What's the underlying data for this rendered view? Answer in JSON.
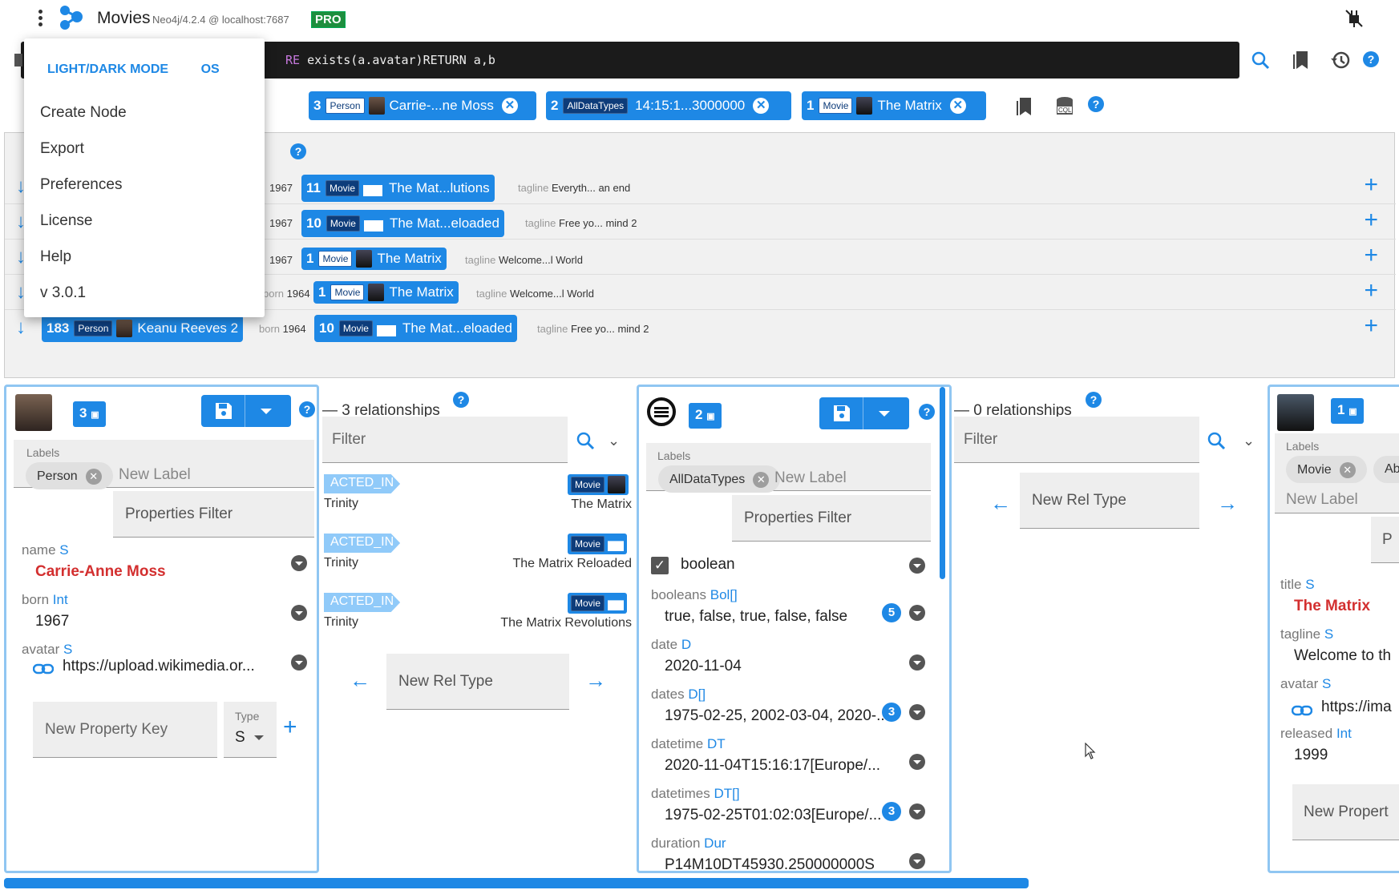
{
  "header": {
    "app_title": "Movies",
    "server": "Neo4j/4.2.4 @ localhost:7687",
    "pro_badge": "PRO"
  },
  "query": {
    "text_kw": "RE",
    "text_rest": " exists(a.avatar)RETURN a,b"
  },
  "menu": {
    "mode_label": "LIGHT/DARK MODE",
    "mode_value": "OS",
    "items": [
      "Create Node",
      "Export",
      "Preferences",
      "License",
      "Help",
      "v 3.0.1"
    ]
  },
  "top_chips": [
    {
      "id": "3",
      "label": "Person",
      "text": "Carrie-...ne Moss"
    },
    {
      "id": "2",
      "label": "AllDataTypes",
      "text": "14:15:1...3000000"
    },
    {
      "id": "1",
      "label": "Movie",
      "text": "The Matrix"
    }
  ],
  "results": {
    "rows": [
      {
        "meta1": "1967",
        "id": "11",
        "label": "Movie",
        "title": "The Mat...lutions",
        "key": "tagline",
        "val": "Everyth... an end"
      },
      {
        "meta1": "1967",
        "id": "10",
        "label": "Movie",
        "title": "The Mat...eloaded",
        "key": "tagline",
        "val": "Free yo... mind 2"
      },
      {
        "meta1": "1967",
        "id": "1",
        "label": "Movie",
        "title": "The Matrix",
        "key": "tagline",
        "val": "Welcome...l World"
      },
      {
        "meta1": "1964",
        "metakey": "born",
        "id": "1",
        "label": "Movie",
        "title": "The Matrix",
        "key": "tagline",
        "val": "Welcome...l World"
      },
      {
        "person_id": "183",
        "person_label": "Person",
        "person_name": "Keanu Reeves 2",
        "metakey": "born",
        "meta1": "1964",
        "id": "10",
        "label": "Movie",
        "title": "The Mat...eloaded",
        "key": "tagline",
        "val": "Free yo... mind 2"
      }
    ]
  },
  "pane1": {
    "cql_count": "3",
    "labels_caption": "Labels",
    "label_chip": "Person",
    "new_label_placeholder": "New Label",
    "properties_filter": "Properties Filter",
    "props": [
      {
        "key": "name",
        "type": "S",
        "value": "Carrie-Anne Moss"
      },
      {
        "key": "born",
        "type": "Int",
        "value": "1967"
      },
      {
        "key": "avatar",
        "type": "S",
        "value": "https://upload.wikimedia.or..."
      }
    ],
    "new_property_key": "New Property Key",
    "type_caption": "Type",
    "type_value": "S"
  },
  "rels1": {
    "count_text": "3 relationships",
    "filter_placeholder": "Filter",
    "items": [
      {
        "type": "ACTED_IN",
        "role": "Trinity",
        "label": "Movie",
        "target": "The Matrix"
      },
      {
        "type": "ACTED_IN",
        "role": "Trinity",
        "label": "Movie",
        "target": "The Matrix Reloaded"
      },
      {
        "type": "ACTED_IN",
        "role": "Trinity",
        "label": "Movie",
        "target": "The Matrix Revolutions"
      }
    ],
    "new_rel_type": "New Rel Type"
  },
  "pane2": {
    "cql_count": "2",
    "labels_caption": "Labels",
    "label_chip": "AllDataTypes",
    "new_label_placeholder": "New Label",
    "properties_filter": "Properties Filter",
    "boolean_key": "boolean",
    "props": [
      {
        "key": "booleans",
        "type": "Bol[]",
        "value": "true, false, true, false, false",
        "badge": "5"
      },
      {
        "key": "date",
        "type": "D",
        "value": "2020-11-04"
      },
      {
        "key": "dates",
        "type": "D[]",
        "value": "1975-02-25, 2002-03-04, 2020-...",
        "badge": "3"
      },
      {
        "key": "datetime",
        "type": "DT",
        "value": "2020-11-04T15:16:17[Europe/..."
      },
      {
        "key": "datetimes",
        "type": "DT[]",
        "value": "1975-02-25T01:02:03[Europe/...",
        "badge": "3"
      },
      {
        "key": "duration",
        "type": "Dur",
        "value": "P14M10DT45930.250000000S"
      }
    ]
  },
  "rels2": {
    "count_text": "0 relationships",
    "filter_placeholder": "Filter",
    "new_rel_type": "New Rel Type"
  },
  "pane3": {
    "cql_count": "1",
    "labels_caption": "Labels",
    "label_chip": "Movie",
    "label_chip2": "Ab",
    "new_label_placeholder": "New Label",
    "pf_fragment": "P",
    "props": [
      {
        "key": "title",
        "type": "S",
        "value": "The Matrix"
      },
      {
        "key": "tagline",
        "type": "S",
        "value": "Welcome to th"
      },
      {
        "key": "avatar",
        "type": "S",
        "value": "https://ima"
      },
      {
        "key": "released",
        "type": "Int",
        "value": "1999"
      }
    ],
    "new_property": "New Propert"
  },
  "colors": {
    "accent": "#1e88e5",
    "pane_border": "#90c6f2",
    "danger": "#d32f2f"
  }
}
